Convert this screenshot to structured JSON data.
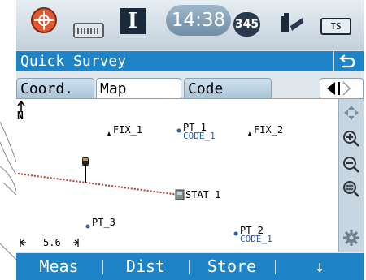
{
  "statusbar": {
    "time": "14:38",
    "satellites": "345",
    "battery_label": "TS",
    "instrument_letter": "I",
    "icons": [
      "target-icon",
      "radio-icon",
      "instrument-icon",
      "satellite-icon",
      "tool-icon",
      "battery-icon"
    ]
  },
  "header": {
    "title": "Quick Survey",
    "back_icon": "return-arrow-icon"
  },
  "tabs": {
    "items": [
      {
        "label": "Coord.",
        "active": false
      },
      {
        "label": "Map",
        "active": true
      },
      {
        "label": "Code",
        "active": false
      }
    ],
    "scroll_icon": "tab-scroll-arrows-icon"
  },
  "map": {
    "north_label": "N",
    "scale_label": "5.6",
    "points": [
      {
        "name": "FIX_1",
        "type": "fixed"
      },
      {
        "name": "PT_1",
        "code": "CODE_1",
        "type": "point"
      },
      {
        "name": "FIX_2",
        "type": "fixed"
      },
      {
        "name": "STAT_1",
        "type": "station"
      },
      {
        "name": "PT_3",
        "type": "point"
      },
      {
        "name": "PT_2",
        "code": "CODE_1",
        "type": "point"
      }
    ],
    "colors": {
      "sight_line": "#c0392b",
      "point": "#2a5fb0",
      "fixed": "#000000"
    }
  },
  "sidebar": {
    "tools": [
      "pan-icon",
      "zoom-in-icon",
      "zoom-out-icon",
      "zoom-extent-icon",
      "settings-gear-icon"
    ]
  },
  "softkeys": {
    "meas": "Meas",
    "dist": "Dist",
    "store": "Store",
    "more": "↓"
  }
}
